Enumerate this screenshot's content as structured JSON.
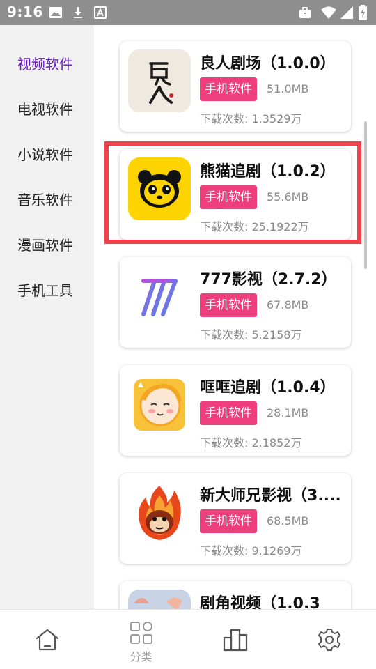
{
  "status_bar": {
    "time": "9:16",
    "left_icons": [
      "image-icon",
      "download-icon",
      "font-icon"
    ],
    "right_icons": [
      "briefcase-icon",
      "wifi-icon",
      "signal-icon",
      "battery-charging-icon"
    ]
  },
  "sidebar": {
    "active_color": "#6a1cc8",
    "items": [
      {
        "label": "视频软件",
        "active": true
      },
      {
        "label": "电视软件",
        "active": false
      },
      {
        "label": "小说软件",
        "active": false
      },
      {
        "label": "音乐软件",
        "active": false
      },
      {
        "label": "漫画软件",
        "active": false
      },
      {
        "label": "手机工具",
        "active": false
      }
    ]
  },
  "apps": [
    {
      "title": "良人剧场（1.0.0）",
      "tag": "手机软件",
      "size": "51.0MB",
      "downloads_label": "下载次数: ",
      "downloads": "1.3529万",
      "icon": "liangren-app-icon"
    },
    {
      "title": "熊猫追剧（1.0.2）",
      "tag": "手机软件",
      "size": "55.6MB",
      "downloads_label": "下载次数: ",
      "downloads": "25.1922万",
      "icon": "panda-app-icon",
      "highlighted": true
    },
    {
      "title": "777影视（2.7.2）",
      "tag": "手机软件",
      "size": "67.8MB",
      "downloads_label": "下载次数: ",
      "downloads": "5.2158万",
      "icon": "777-app-icon"
    },
    {
      "title": "哐哐追剧（1.0.4）",
      "tag": "手机软件",
      "size": "28.1MB",
      "downloads_label": "下载次数: ",
      "downloads": "2.1852万",
      "icon": "kuangkuang-app-icon"
    },
    {
      "title": "新大师兄影视（3....",
      "tag": "手机软件",
      "size": "68.5MB",
      "downloads_label": "下载次数: ",
      "downloads": "9.1269万",
      "icon": "fire-monkey-app-icon"
    },
    {
      "title": "剧角视频（1.0.3",
      "tag": "",
      "size": "",
      "downloads_label": "",
      "downloads": "",
      "icon": "jujiao-app-icon"
    }
  ],
  "colors": {
    "tag_bg": "#ee3e7c",
    "highlight_border": "#f2414a",
    "status_bar_bg": "#8e8e8e"
  },
  "bottom_nav": {
    "items": [
      {
        "icon": "home-icon",
        "label": ""
      },
      {
        "icon": "category-icon",
        "label": "分类"
      },
      {
        "icon": "ranking-icon",
        "label": ""
      },
      {
        "icon": "settings-icon",
        "label": ""
      }
    ]
  }
}
